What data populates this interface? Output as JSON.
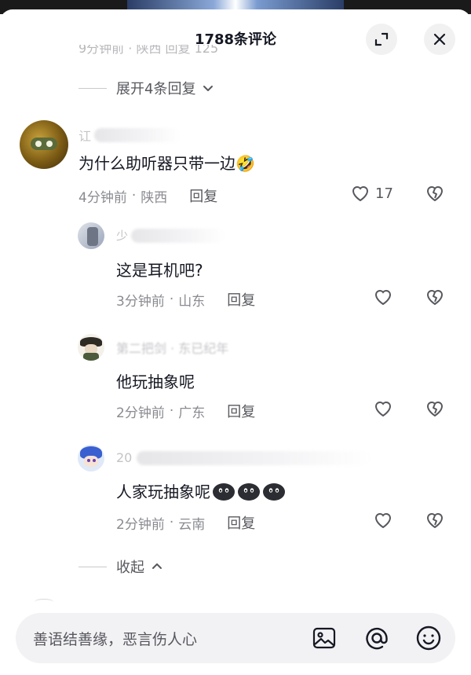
{
  "header": {
    "title": "1788条评论"
  },
  "previous_row": {
    "text": "9分钟前 · 陕西   回复                                                      125"
  },
  "expand_replies_label": "展开4条回复",
  "collapse_replies_label": "收起",
  "main_comment": {
    "username": "讧",
    "text": "为什么助听器只带一边🤣",
    "time": "4分钟前",
    "location": "陕西",
    "reply_label": "回复",
    "like_count": "17"
  },
  "replies": [
    {
      "username": "少",
      "text": "这是耳机吧?",
      "time": "3分钟前",
      "location": "山东",
      "reply_label": "回复"
    },
    {
      "username": "第二把剑 · 东已纪年",
      "text": "他玩抽象呢",
      "time": "2分钟前",
      "location": "广东",
      "reply_label": "回复"
    },
    {
      "username": "20",
      "text": "人家玩抽象呢",
      "time": "2分钟前",
      "location": "云南",
      "reply_label": "回复"
    }
  ],
  "input": {
    "placeholder": "善语结善缘，恶言伤人心"
  },
  "icons": {
    "expand": "expand-icon",
    "close": "close-icon",
    "heart": "heart-icon",
    "broken_heart": "broken-heart-icon",
    "image": "image-icon",
    "at": "at-icon",
    "emoji": "emoji-icon"
  },
  "colors": {
    "text_primary": "#161823",
    "text_secondary": "#8a8b91",
    "input_bg": "#f2f2f4"
  }
}
